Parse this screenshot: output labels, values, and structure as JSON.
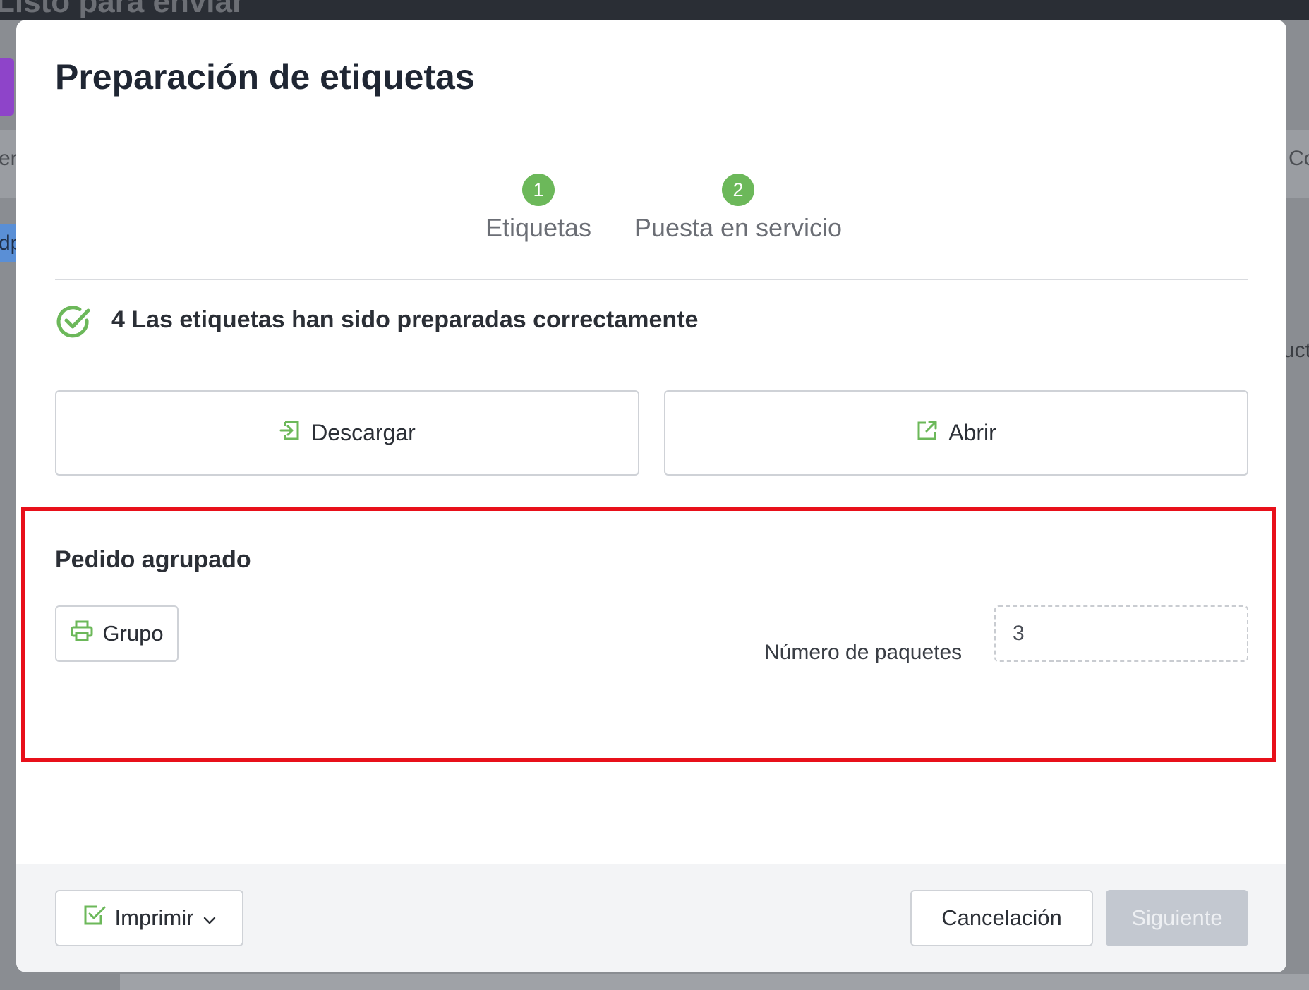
{
  "background": {
    "title": "Listo para enviar",
    "left_text_1": "er",
    "left_text_2": "dp",
    "right_text_1": "Co",
    "right_text_2": "uct"
  },
  "modal": {
    "title": "Preparación de etiquetas",
    "steps": [
      {
        "number": "1",
        "label": "Etiquetas"
      },
      {
        "number": "2",
        "label": "Puesta en servicio"
      }
    ],
    "success_message": "4 Las etiquetas han sido preparadas correctamente",
    "download_label": "Descargar",
    "open_label": "Abrir",
    "grouped_section": {
      "title": "Pedido agrupado",
      "group_button_label": "Grupo",
      "packages_label": "Número de paquetes",
      "packages_value": "3"
    },
    "footer": {
      "print_label": "Imprimir",
      "cancel_label": "Cancelación",
      "next_label": "Siguiente"
    }
  },
  "colors": {
    "accent_green": "#6cb85a",
    "highlight_red": "#e8101a",
    "disabled_button": "#c3c8d0"
  }
}
